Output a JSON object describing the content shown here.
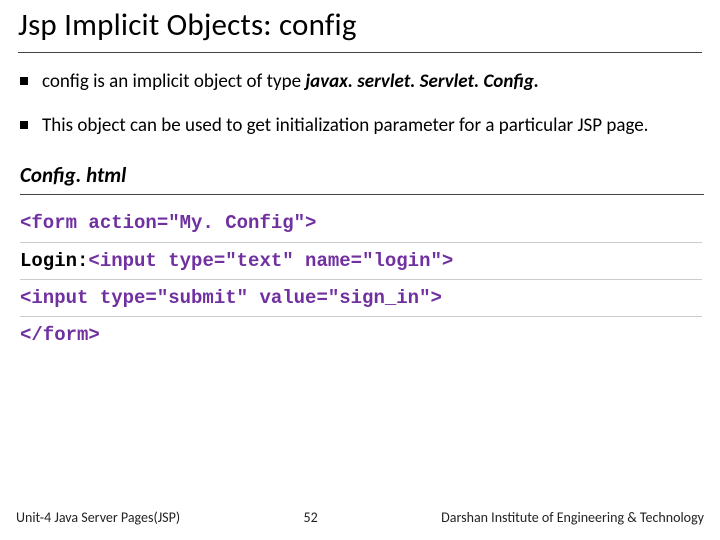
{
  "title": "Jsp Implicit Objects: config",
  "bullets": [
    {
      "pre": "config is an implicit object of type ",
      "emph": "javax. servlet. Servlet. Config.",
      "post": ""
    },
    {
      "pre": "This object can be used to get initialization parameter for a particular JSP page.",
      "emph": "",
      "post": ""
    }
  ],
  "subhead": "Config. html",
  "code": {
    "l1a": "<form action=\"My. Config\">",
    "l2a": "Login:",
    "l2b": "<input type=\"text\" name=\"login\">",
    "l3a": "<input type=\"submit\" value=\"sign_in\">",
    "l4a": "</form>"
  },
  "footer": {
    "left": "Unit-4 Java Server Pages(JSP)",
    "mid": "52",
    "right": "Darshan Institute of Engineering & Technology"
  }
}
